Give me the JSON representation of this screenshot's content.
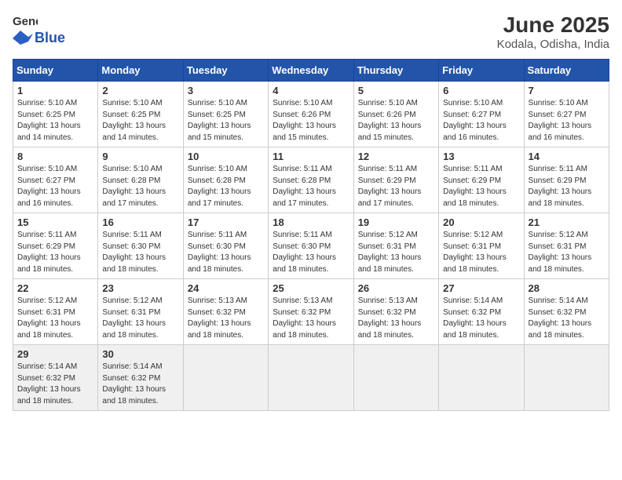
{
  "logo": {
    "general": "General",
    "blue": "Blue"
  },
  "title": "June 2025",
  "location": "Kodala, Odisha, India",
  "headers": [
    "Sunday",
    "Monday",
    "Tuesday",
    "Wednesday",
    "Thursday",
    "Friday",
    "Saturday"
  ],
  "weeks": [
    [
      {
        "day": "1",
        "sunrise": "5:10 AM",
        "sunset": "6:25 PM",
        "daylight": "13 hours and 14 minutes."
      },
      {
        "day": "2",
        "sunrise": "5:10 AM",
        "sunset": "6:25 PM",
        "daylight": "13 hours and 14 minutes."
      },
      {
        "day": "3",
        "sunrise": "5:10 AM",
        "sunset": "6:25 PM",
        "daylight": "13 hours and 15 minutes."
      },
      {
        "day": "4",
        "sunrise": "5:10 AM",
        "sunset": "6:26 PM",
        "daylight": "13 hours and 15 minutes."
      },
      {
        "day": "5",
        "sunrise": "5:10 AM",
        "sunset": "6:26 PM",
        "daylight": "13 hours and 15 minutes."
      },
      {
        "day": "6",
        "sunrise": "5:10 AM",
        "sunset": "6:27 PM",
        "daylight": "13 hours and 16 minutes."
      },
      {
        "day": "7",
        "sunrise": "5:10 AM",
        "sunset": "6:27 PM",
        "daylight": "13 hours and 16 minutes."
      }
    ],
    [
      {
        "day": "8",
        "sunrise": "5:10 AM",
        "sunset": "6:27 PM",
        "daylight": "13 hours and 16 minutes."
      },
      {
        "day": "9",
        "sunrise": "5:10 AM",
        "sunset": "6:28 PM",
        "daylight": "13 hours and 17 minutes."
      },
      {
        "day": "10",
        "sunrise": "5:10 AM",
        "sunset": "6:28 PM",
        "daylight": "13 hours and 17 minutes."
      },
      {
        "day": "11",
        "sunrise": "5:11 AM",
        "sunset": "6:28 PM",
        "daylight": "13 hours and 17 minutes."
      },
      {
        "day": "12",
        "sunrise": "5:11 AM",
        "sunset": "6:29 PM",
        "daylight": "13 hours and 17 minutes."
      },
      {
        "day": "13",
        "sunrise": "5:11 AM",
        "sunset": "6:29 PM",
        "daylight": "13 hours and 18 minutes."
      },
      {
        "day": "14",
        "sunrise": "5:11 AM",
        "sunset": "6:29 PM",
        "daylight": "13 hours and 18 minutes."
      }
    ],
    [
      {
        "day": "15",
        "sunrise": "5:11 AM",
        "sunset": "6:29 PM",
        "daylight": "13 hours and 18 minutes."
      },
      {
        "day": "16",
        "sunrise": "5:11 AM",
        "sunset": "6:30 PM",
        "daylight": "13 hours and 18 minutes."
      },
      {
        "day": "17",
        "sunrise": "5:11 AM",
        "sunset": "6:30 PM",
        "daylight": "13 hours and 18 minutes."
      },
      {
        "day": "18",
        "sunrise": "5:11 AM",
        "sunset": "6:30 PM",
        "daylight": "13 hours and 18 minutes."
      },
      {
        "day": "19",
        "sunrise": "5:12 AM",
        "sunset": "6:31 PM",
        "daylight": "13 hours and 18 minutes."
      },
      {
        "day": "20",
        "sunrise": "5:12 AM",
        "sunset": "6:31 PM",
        "daylight": "13 hours and 18 minutes."
      },
      {
        "day": "21",
        "sunrise": "5:12 AM",
        "sunset": "6:31 PM",
        "daylight": "13 hours and 18 minutes."
      }
    ],
    [
      {
        "day": "22",
        "sunrise": "5:12 AM",
        "sunset": "6:31 PM",
        "daylight": "13 hours and 18 minutes."
      },
      {
        "day": "23",
        "sunrise": "5:12 AM",
        "sunset": "6:31 PM",
        "daylight": "13 hours and 18 minutes."
      },
      {
        "day": "24",
        "sunrise": "5:13 AM",
        "sunset": "6:32 PM",
        "daylight": "13 hours and 18 minutes."
      },
      {
        "day": "25",
        "sunrise": "5:13 AM",
        "sunset": "6:32 PM",
        "daylight": "13 hours and 18 minutes."
      },
      {
        "day": "26",
        "sunrise": "5:13 AM",
        "sunset": "6:32 PM",
        "daylight": "13 hours and 18 minutes."
      },
      {
        "day": "27",
        "sunrise": "5:14 AM",
        "sunset": "6:32 PM",
        "daylight": "13 hours and 18 minutes."
      },
      {
        "day": "28",
        "sunrise": "5:14 AM",
        "sunset": "6:32 PM",
        "daylight": "13 hours and 18 minutes."
      }
    ],
    [
      {
        "day": "29",
        "sunrise": "5:14 AM",
        "sunset": "6:32 PM",
        "daylight": "13 hours and 18 minutes."
      },
      {
        "day": "30",
        "sunrise": "5:14 AM",
        "sunset": "6:32 PM",
        "daylight": "13 hours and 18 minutes."
      },
      null,
      null,
      null,
      null,
      null
    ]
  ]
}
